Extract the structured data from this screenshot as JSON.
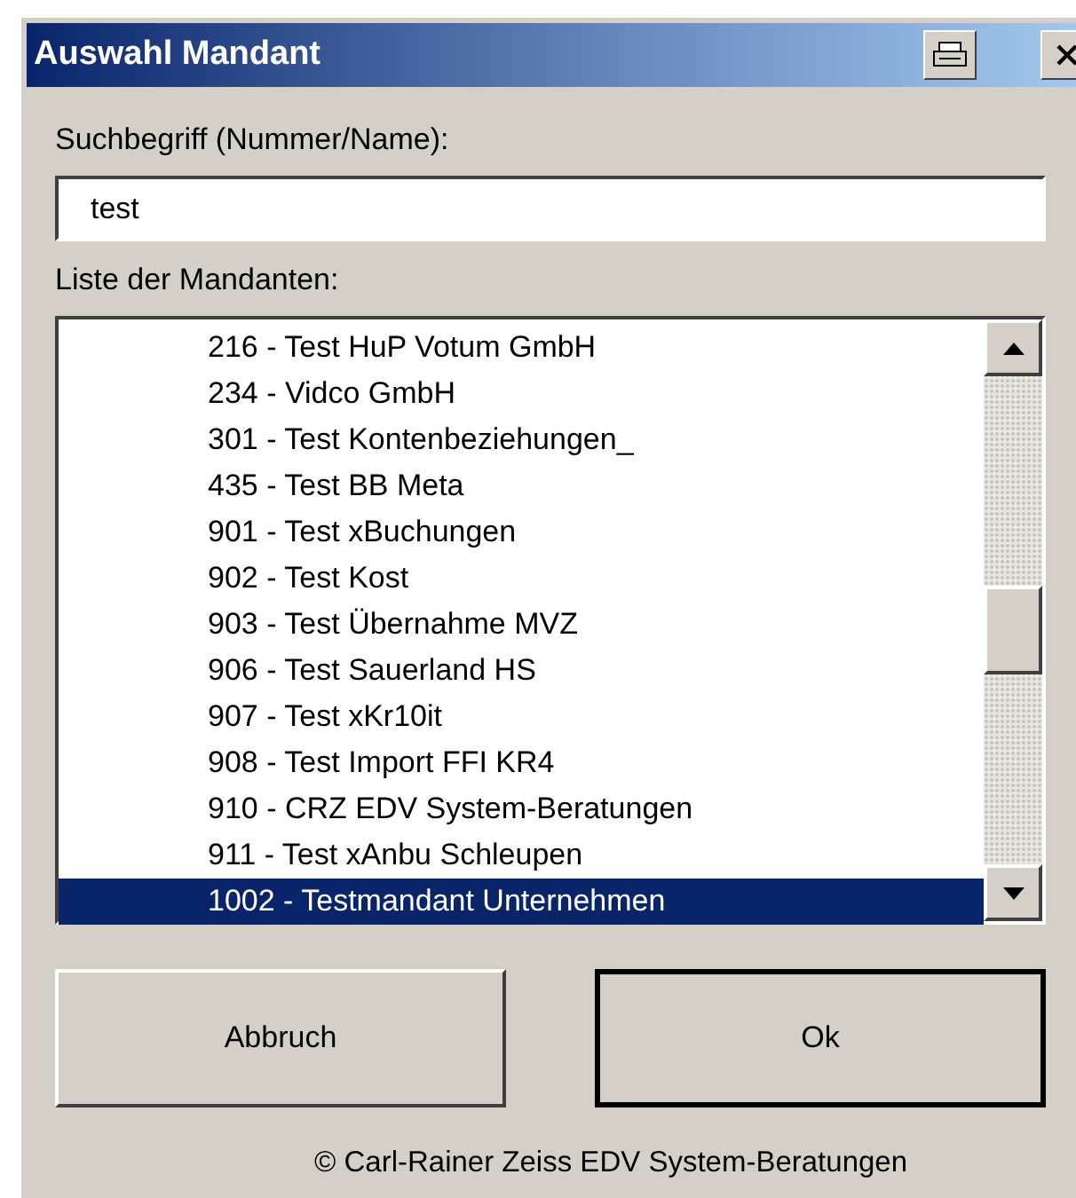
{
  "window": {
    "title": "Auswahl Mandant"
  },
  "search": {
    "label": "Suchbegriff (Nummer/Name):",
    "value": "test"
  },
  "list": {
    "label": "Liste der Mandanten:",
    "items": [
      {
        "text": "216 - Test HuP Votum GmbH",
        "selected": false
      },
      {
        "text": "234 - Vidco GmbH",
        "selected": false
      },
      {
        "text": "301 - Test Kontenbeziehungen_",
        "selected": false
      },
      {
        "text": "435 - Test BB Meta",
        "selected": false
      },
      {
        "text": "901 - Test xBuchungen",
        "selected": false
      },
      {
        "text": "902 - Test Kost",
        "selected": false
      },
      {
        "text": "903 - Test Übernahme MVZ",
        "selected": false
      },
      {
        "text": "906 - Test Sauerland HS",
        "selected": false
      },
      {
        "text": "907 - Test xKr10it",
        "selected": false
      },
      {
        "text": "908 - Test Import FFI KR4",
        "selected": false
      },
      {
        "text": "910 - CRZ EDV System-Beratungen",
        "selected": false
      },
      {
        "text": "911 - Test xAnbu Schleupen",
        "selected": false
      },
      {
        "text": "1002 - Testmandant Unternehmen",
        "selected": true
      }
    ]
  },
  "buttons": [
    {
      "label": "Abbruch",
      "default": false
    },
    {
      "label": "Ok",
      "default": true
    }
  ],
  "footer": "© Carl-Rainer Zeiss EDV System-Beratungen"
}
